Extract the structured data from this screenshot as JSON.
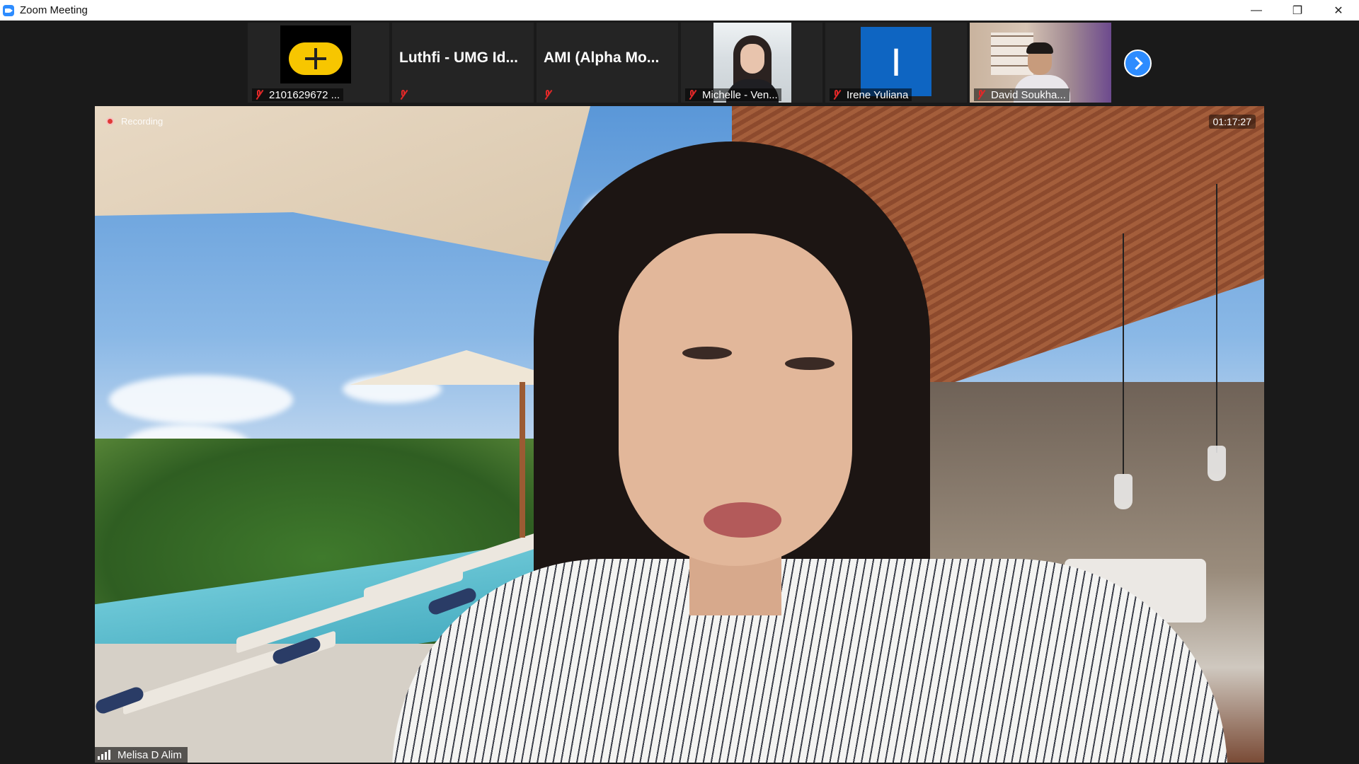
{
  "window": {
    "title": "Zoom Meeting",
    "controls": {
      "minimize": "—",
      "maximize": "❐",
      "close": "✕"
    }
  },
  "filmstrip": {
    "participants": [
      {
        "name": "2101629672 ...",
        "muted": true,
        "avatar": "yellow-plus-logo"
      },
      {
        "name": "Luthfi - UMG Id...",
        "muted": true,
        "avatar": "name-only"
      },
      {
        "name": "AMI (Alpha Mo...",
        "muted": true,
        "avatar": "name-only"
      },
      {
        "name": "Michelle - Ven...",
        "muted": true,
        "avatar": "video"
      },
      {
        "name": "Irene Yuliana",
        "muted": true,
        "avatar": "initial",
        "initial": "I"
      },
      {
        "name": "David Soukha...",
        "muted": true,
        "avatar": "video"
      }
    ],
    "next_page_icon": "chevron-right-icon"
  },
  "main_video": {
    "speaker_name": "Melisa D Alim",
    "recording_label": "Recording",
    "elapsed_time": "01:17:27"
  },
  "colors": {
    "zoom_blue": "#2d8cff",
    "mute_red": "#e02828",
    "avatar_blue": "#0e65c2",
    "avatar_yellow": "#f7c600"
  }
}
